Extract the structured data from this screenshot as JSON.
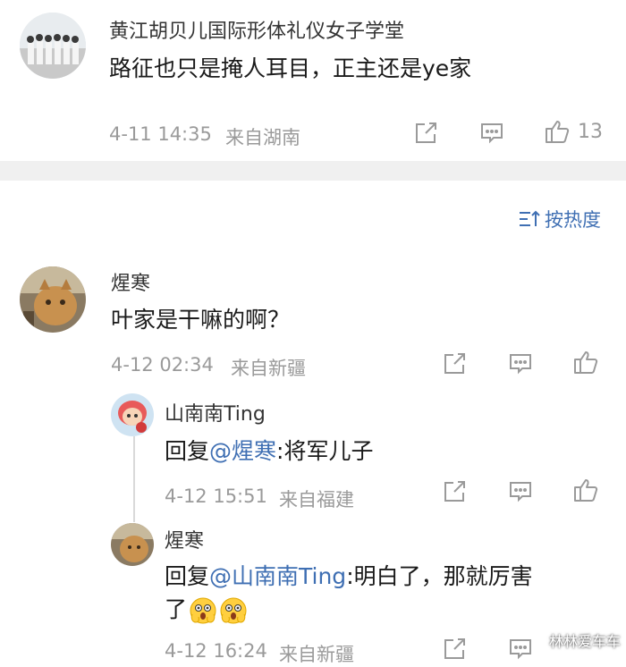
{
  "comments": [
    {
      "user": "黄江胡贝儿国际形体礼仪女子学堂",
      "text": "路征也只是掩人耳目，正主还是ye家",
      "time": "4-11 14:35",
      "location": "来自湖南",
      "likes": "13"
    },
    {
      "user": "煋寒",
      "text": "叶家是干嘛的啊？",
      "time": "4-12 02:34",
      "location": "来自新疆"
    },
    {
      "user": "山南南Ting",
      "reply_prefix": "回复",
      "mention": "@煋寒",
      "reply_text": ":将军儿子",
      "time": "4-12 15:51",
      "location": "来自福建"
    },
    {
      "user": "煋寒",
      "reply_prefix": "回复",
      "mention": "@山南南Ting",
      "reply_text": ":明白了，那就厉害",
      "reply_text_line2": "了",
      "time": "4-12 16:24",
      "location": "来自新疆"
    }
  ],
  "sort": {
    "label": "按热度"
  },
  "watermark": "林林爱车车",
  "icons": {
    "share": "share-icon",
    "comment": "comment-icon",
    "like": "like-icon",
    "sort": "sort-icon",
    "emoji": "shocked-face-emoji"
  },
  "colors": {
    "mention": "#3f6fb3",
    "meta": "#9a9a9a",
    "divider": "#f0f0f0"
  }
}
